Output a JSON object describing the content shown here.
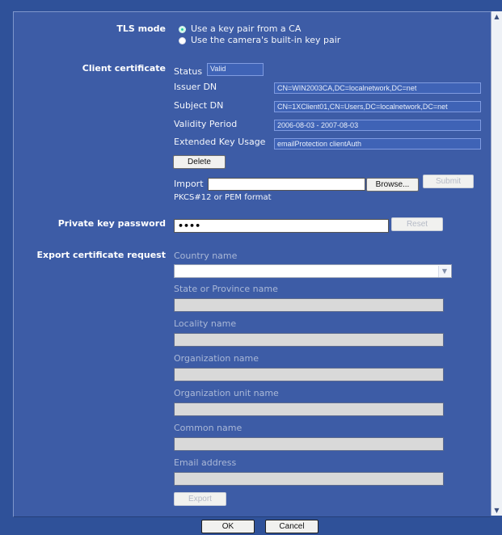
{
  "tls": {
    "label": "TLS mode",
    "options": [
      {
        "label": "Use a key pair from a CA",
        "selected": true
      },
      {
        "label": "Use the camera's built-in key pair",
        "selected": false
      }
    ]
  },
  "client_cert": {
    "label": "Client certificate",
    "status_label": "Status",
    "status_value": "Valid",
    "issuer_label": "Issuer DN",
    "issuer_value": "CN=WIN2003CA,DC=localnetwork,DC=net",
    "subject_label": "Subject DN",
    "subject_value": "CN=1XClient01,CN=Users,DC=localnetwork,DC=net",
    "validity_label": "Validity Period",
    "validity_value": "2006-08-03 - 2007-08-03",
    "eku_label": "Extended Key Usage",
    "eku_value": "emailProtection clientAuth",
    "delete_label": "Delete",
    "import_label": "Import",
    "import_value": "",
    "browse_label": "Browse...",
    "submit_label": "Submit",
    "format_note": "PKCS#12 or PEM format"
  },
  "private_key": {
    "label": "Private key password",
    "value": "••••",
    "reset_label": "Reset"
  },
  "export_req": {
    "label": "Export certificate request",
    "country_label": "Country name",
    "country_value": "",
    "state_label": "State or Province name",
    "locality_label": "Locality name",
    "org_label": "Organization name",
    "org_unit_label": "Organization unit name",
    "common_label": "Common name",
    "email_label": "Email address",
    "export_label": "Export"
  },
  "footer": {
    "ok_label": "OK",
    "cancel_label": "Cancel"
  },
  "colors": {
    "background": "#2f5199",
    "panel": "#3d5ca6",
    "accent_radio": "#1fd1a1"
  }
}
